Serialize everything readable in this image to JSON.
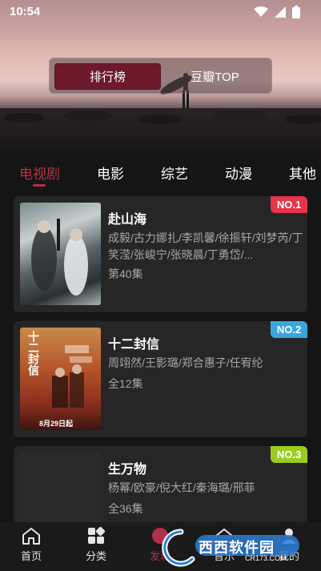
{
  "status": {
    "time": "10:54"
  },
  "segment": {
    "left": "排行榜",
    "right": "豆瓣TOP"
  },
  "tabs": [
    "电视剧",
    "电影",
    "综艺",
    "动漫",
    "其他"
  ],
  "cards": [
    {
      "badge": "NO.1",
      "badge_color": "#e8334a",
      "title": "赴山海",
      "cast": "成毅/古力娜扎/李凯馨/徐振轩/刘梦芮/丁笑滢/张峻宁/张晓晨/丁勇岱/...",
      "episodes": "第40集"
    },
    {
      "badge": "NO.2",
      "badge_color": "#3aa6e0",
      "title": "十二封信",
      "cast": "周翊然/王影璐/郑合惠子/任宥纶",
      "episodes": "全12集",
      "poster_text": "十二封信",
      "poster_date": "8月29日起"
    },
    {
      "badge": "NO.3",
      "badge_color": "#9ccc1e",
      "title": "生万物",
      "cast": "杨幂/欧豪/倪大红/秦海璐/邢菲",
      "episodes": "全36集"
    }
  ],
  "nav": [
    {
      "label": "首页",
      "icon": "home-icon"
    },
    {
      "label": "分类",
      "icon": "grid-icon"
    },
    {
      "label": "发现",
      "icon": "discover-icon"
    },
    {
      "label": "音乐",
      "icon": "music-icon"
    },
    {
      "label": "我的",
      "icon": "user-icon"
    }
  ],
  "watermark": {
    "text": "西西软件园",
    "url": "CR173.COM"
  },
  "colors": {
    "accent": "#b0304b",
    "card_bg": "#262626",
    "page_bg": "#151515"
  }
}
